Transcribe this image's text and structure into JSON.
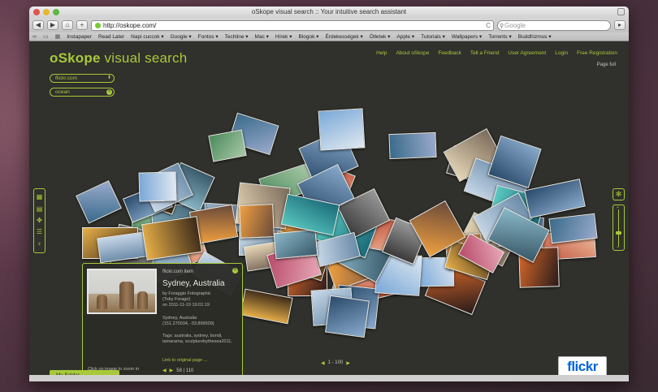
{
  "window": {
    "title": "oSkope visual search :: Your intuitive search assistant"
  },
  "toolbar": {
    "back": "◀",
    "forward": "▶",
    "home": "⌂",
    "add": "+",
    "url": "http://oskope.com/",
    "reload": "C",
    "search_placeholder": "Google",
    "page_menu": "▸"
  },
  "bookmarks": [
    "Instapaper",
    "Read Later",
    "Napi cuccok ▾",
    "Google ▾",
    "Fontos ▾",
    "Techline ▾",
    "Mac ▾",
    "Hírek ▾",
    "Blogok ▾",
    "Érdekességek ▾",
    "Ötletek ▾",
    "Apple ▾",
    "Tutorials ▾",
    "Wallpapers ▾",
    "Torrents ▾",
    "Buddhizmus ▾"
  ],
  "site": {
    "logo_bold": "oSkope",
    "logo_rest": " visual search",
    "nav": [
      "Help",
      "About oSkope",
      "Feedback",
      "Tell a Friend",
      "User Agreement",
      "Login",
      "Free Registration"
    ],
    "page_full": "Page full",
    "source_select": "flickr.com",
    "search_value": "ocean"
  },
  "info": {
    "source": "flickr.com item",
    "title": "Sydney, Australia",
    "by": "by Foraggio Fotographic",
    "by2": "(Toby Forage)",
    "date": "on 2011-11-19 19:01:19",
    "location": "Sydney, Australia",
    "coords": "(151.270034, -33.899509)",
    "tags": "Tags: australia, sydney, bondi, tamarama, sculpturebythesea2011,",
    "link": "Link to original page ...",
    "hint": "Click on image to zoom in",
    "pager_text": "58 | 110"
  },
  "pager": {
    "text": "1 - 100"
  },
  "myfolder": "My Folder",
  "flickr_a": "flickr",
  "flickr_b": "",
  "colors": {
    "accent": "#a7c93a",
    "page_bg": "#30302c"
  }
}
